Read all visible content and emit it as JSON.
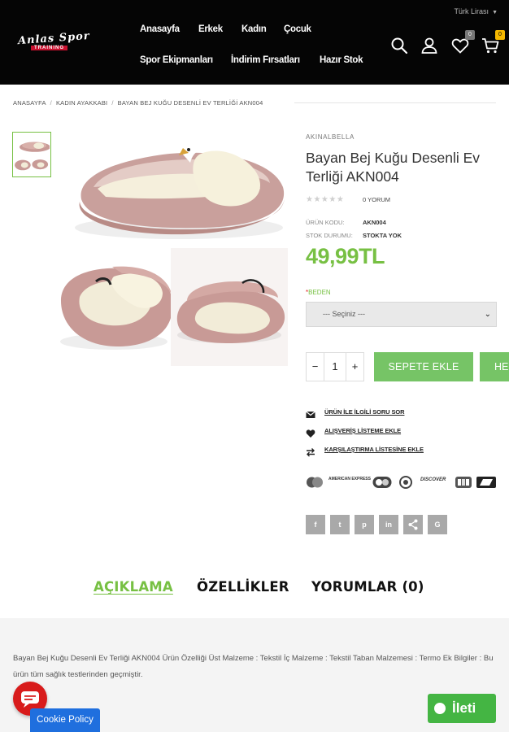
{
  "header": {
    "currency": "Türk Lirası",
    "logo_line1": "Anlas Spor",
    "logo_line2": "TRAINING",
    "nav": [
      "Anasayfa",
      "Erkek",
      "Kadın",
      "Çocuk",
      "Spor Ekipmanları",
      "İndirim Fırsatları",
      "Hazır Stok"
    ],
    "wishlist_count": "0",
    "cart_count": "0"
  },
  "breadcrumb": [
    "ANASAYFA",
    "KADIN AYAKKABI",
    "BAYAN BEJ KUĞU DESENLİ EV TERLİĞİ AKN004"
  ],
  "product": {
    "brand": "AKINALBELLA",
    "title": "Bayan Bej Kuğu Desenli Ev Terliği AKN004",
    "rating_stars": "★★★★★",
    "rating": 0,
    "reviews": "0 YORUM",
    "code_label": "ÜRÜN KODU:",
    "code_value": "AKN004",
    "stock_label": "STOK DURUMU:",
    "stock_value": "STOKTA YOK",
    "price": "49,99TL",
    "size_label": "BEDEN",
    "size_required": "*",
    "size_selected": "--- Seçiniz ---",
    "qty": "1",
    "qty_minus": "−",
    "qty_plus": "+",
    "add_to_cart": "SEPETE EKLE",
    "buy_now": "HEMEN AL",
    "links": [
      "ÜRÜN İLE İLGİLİ SORU SOR",
      "ALIŞVERİŞ LİSTEME EKLE",
      "KARŞILAŞTIRMA LİSTESİNE EKLE"
    ],
    "payment_methods": [
      "AMERICAN EXPRESS",
      "DISCOVER"
    ],
    "share_buttons": [
      "f",
      "t",
      "p",
      "in",
      "share",
      "G"
    ]
  },
  "tabs": [
    "AÇIKLAMA",
    "ÖZELLİKLER",
    "YORUMLAR (0)"
  ],
  "description": "Bayan Bej Kuğu Desenli Ev Terliği AKN004 Ürün Özelliği Üst Malzeme : Tekstil İç Malzeme : Tekstil Taban Malzemesi : Termo Ek Bilgiler : Bu ürün tüm sağlık testlerinden geçmiştir.",
  "widgets": {
    "cookie": "Cookie Policy",
    "whatsapp": "İleti"
  },
  "colors": {
    "accent": "#77c043",
    "header_bg": "#050505",
    "cookie": "#1f6fde",
    "chat": "#d81b1b"
  }
}
